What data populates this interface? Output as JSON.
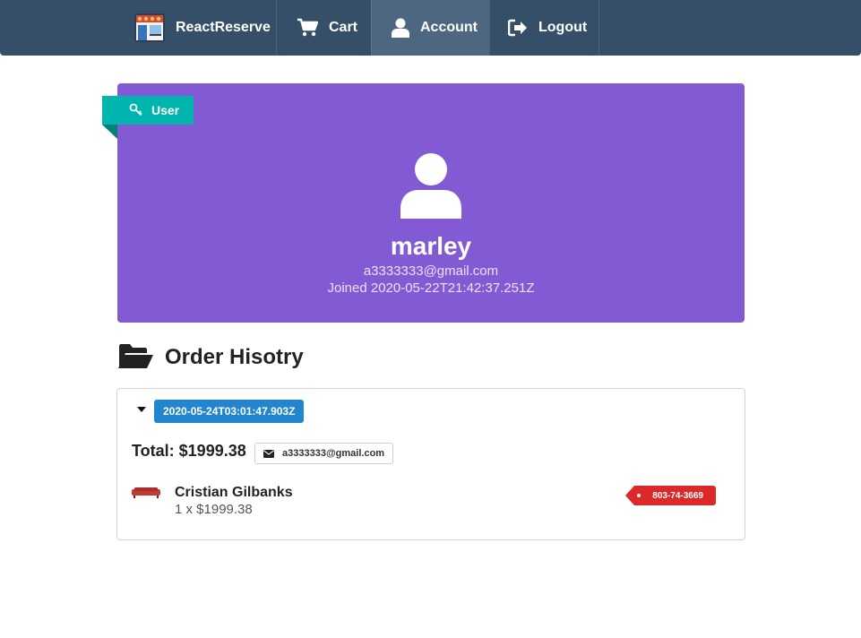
{
  "nav": {
    "brand": "ReactReserve",
    "cart": "Cart",
    "account": "Account",
    "logout": "Logout",
    "active": "Account",
    "icons": [
      "store-logo-icon",
      "cart-icon",
      "user-icon",
      "sign-out-icon"
    ]
  },
  "profile": {
    "role_label": "User",
    "role_icon": "key-icon",
    "name": "marley",
    "email": "a3333333@gmail.com",
    "joined": "Joined 2020-05-22T21:42:37.251Z",
    "background_color": "#825ad4",
    "ribbon_color": "#00b5ad"
  },
  "order_history": {
    "title": "Order Hisotry",
    "title_icon": "folder-open-icon",
    "orders": [
      {
        "date": "2020-05-24T03:01:47.903Z",
        "total": "Total: $1999.38",
        "email": "a3333333@gmail.com",
        "products": [
          {
            "name": "Cristian Gilbanks",
            "quantity_price": "1 x $1999.38",
            "sku": "803-74-3669",
            "image": "red-sofa-thumbnail"
          }
        ]
      }
    ]
  },
  "colors": {
    "navbar": "#364f69",
    "nav_active": "#4e6780",
    "date_badge": "#2185d0",
    "sku_tag": "#db2828"
  }
}
